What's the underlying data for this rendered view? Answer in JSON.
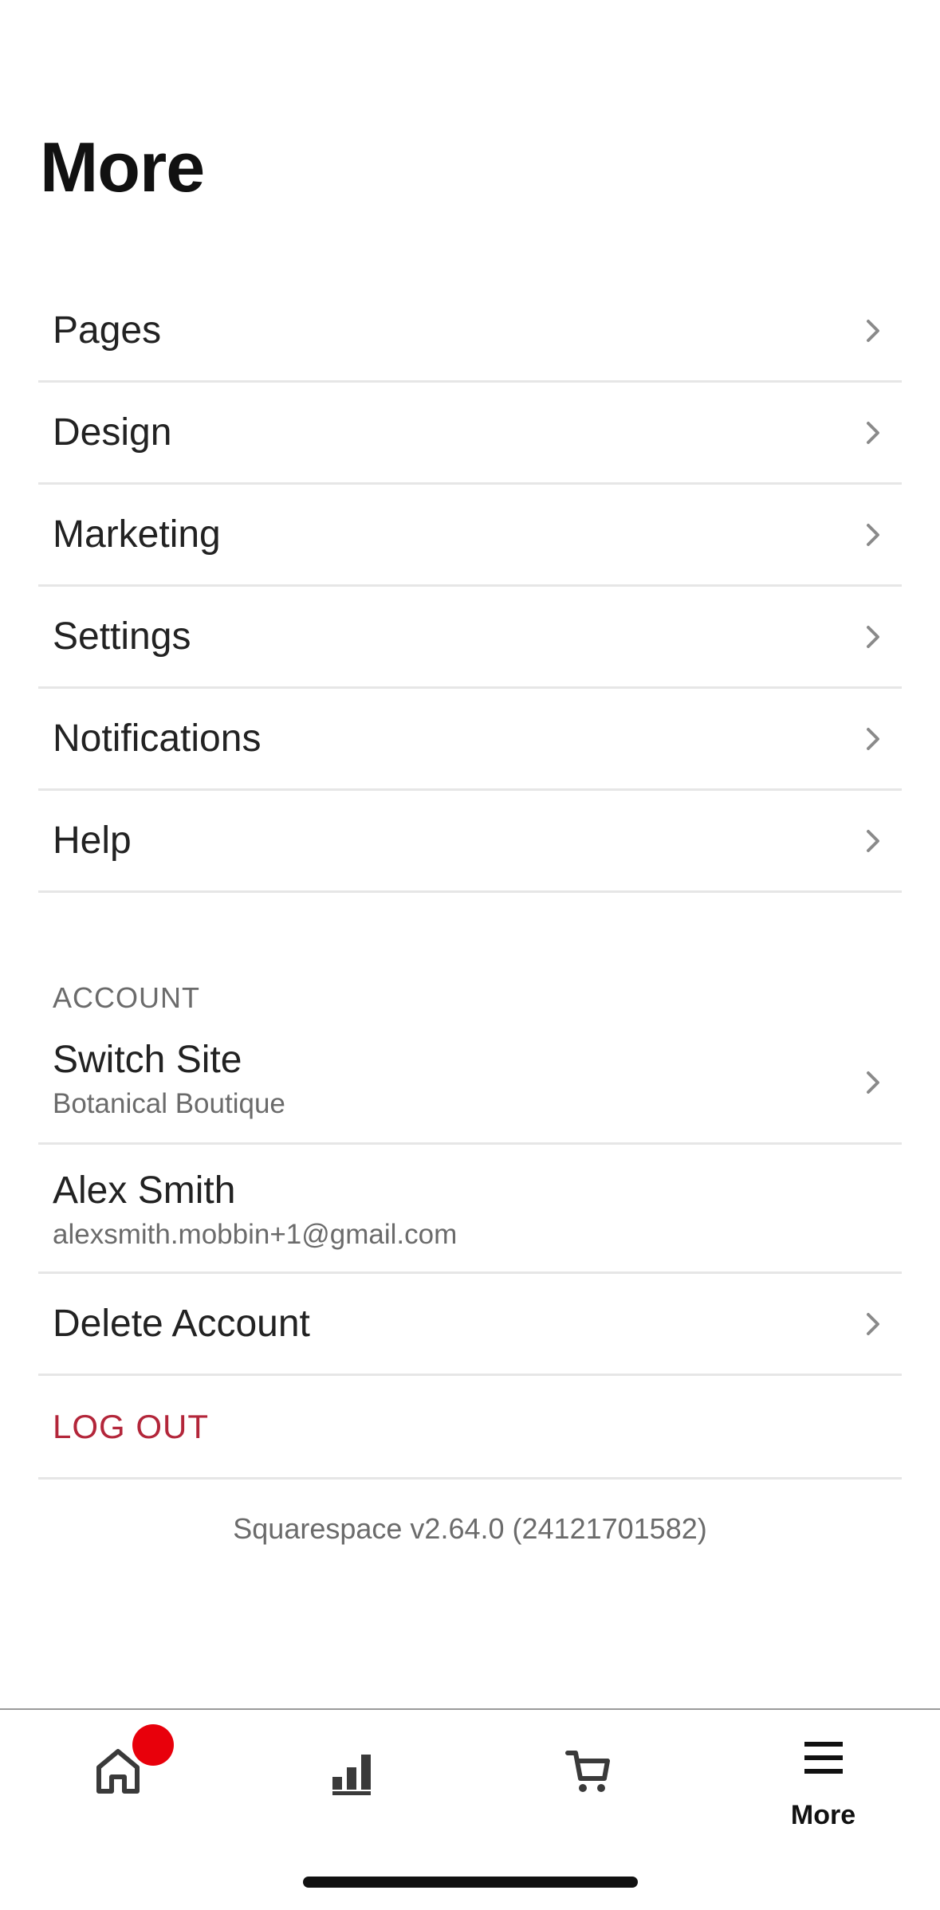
{
  "page": {
    "title": "More"
  },
  "menu": {
    "items": [
      {
        "label": "Pages"
      },
      {
        "label": "Design"
      },
      {
        "label": "Marketing"
      },
      {
        "label": "Settings"
      },
      {
        "label": "Notifications"
      },
      {
        "label": "Help"
      }
    ]
  },
  "account": {
    "header": "ACCOUNT",
    "switch_site": {
      "label": "Switch Site",
      "site_name": "Botanical Boutique"
    },
    "user": {
      "name": "Alex Smith",
      "email": "alexsmith.mobbin+1@gmail.com"
    },
    "delete_label": "Delete Account",
    "logout_label": "LOG OUT"
  },
  "footer": {
    "version": "Squarespace v2.64.0 (24121701582)"
  },
  "tab_bar": {
    "tabs": [
      {
        "icon": "home-icon",
        "label": ""
      },
      {
        "icon": "analytics-icon",
        "label": ""
      },
      {
        "icon": "cart-icon",
        "label": ""
      },
      {
        "icon": "hamburger-menu-icon",
        "label": "More"
      }
    ],
    "active_tab": "More"
  },
  "colors": {
    "logout": "#b3263a",
    "badge": "#e8000b",
    "divider": "#e6e6e6",
    "chevron": "#8a8a8a"
  }
}
